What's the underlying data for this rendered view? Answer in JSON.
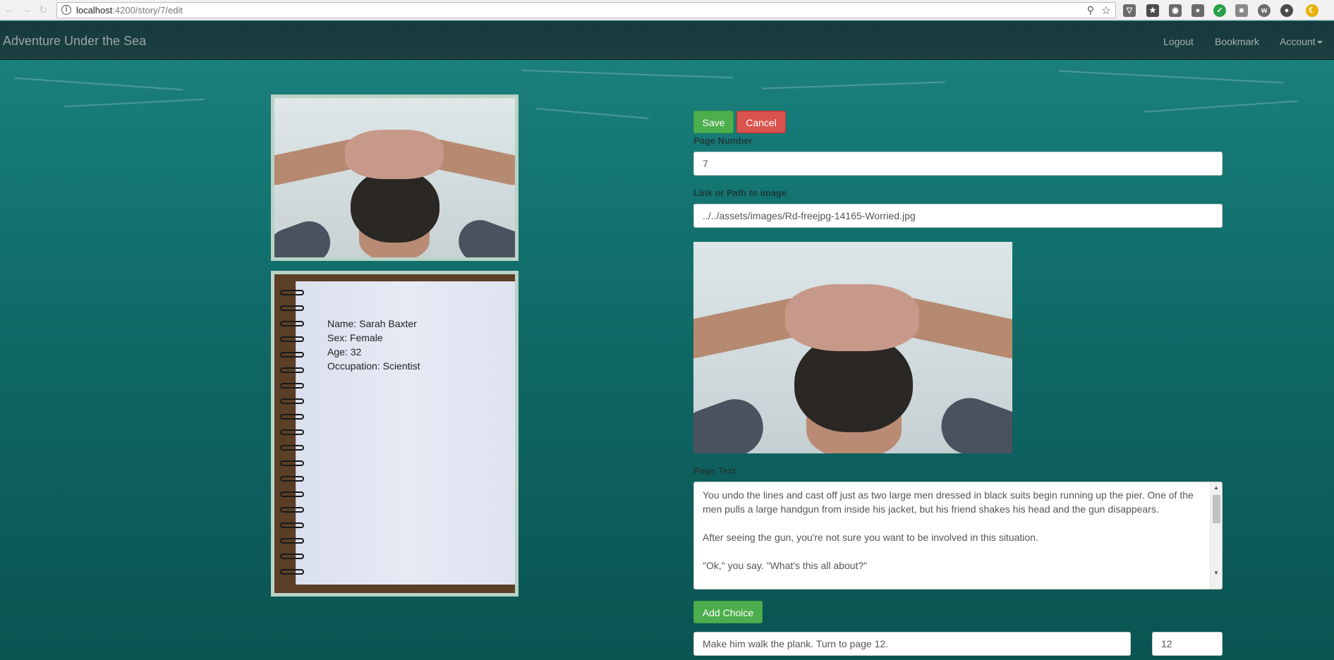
{
  "browser": {
    "url_host": "localhost",
    "url_path": ":4200/story/7/edit"
  },
  "navbar": {
    "brand": "Adventure Under the Sea",
    "links": [
      "Logout",
      "Bookmark",
      "Account"
    ]
  },
  "character": {
    "name": "Name: Sarah Baxter",
    "sex": "Sex: Female",
    "age": "Age: 32",
    "occupation": "Occupation: Scientist"
  },
  "form": {
    "save_label": "Save",
    "cancel_label": "Cancel",
    "page_number_label": "Page Number",
    "page_number_value": "7",
    "image_label": "Link or Path to image",
    "image_value": "../../assets/images/Rd-freejpg-14165-Worried.jpg",
    "page_text_label": "Page Text",
    "page_text_paragraphs": [
      "You undo the lines and cast off just as two large men dressed in black suits begin running up the pier. One of the men pulls a large handgun from inside his jacket, but his friend shakes his head and the gun disappears.",
      "After seeing the gun, you're not sure you want to be involved in this situation.",
      "\"Ok,\" you say. \"What's this all about?\""
    ],
    "add_choice_label": "Add Choice",
    "choice_text": "Make him walk the plank. Turn to page 12.",
    "choice_page": "12"
  }
}
